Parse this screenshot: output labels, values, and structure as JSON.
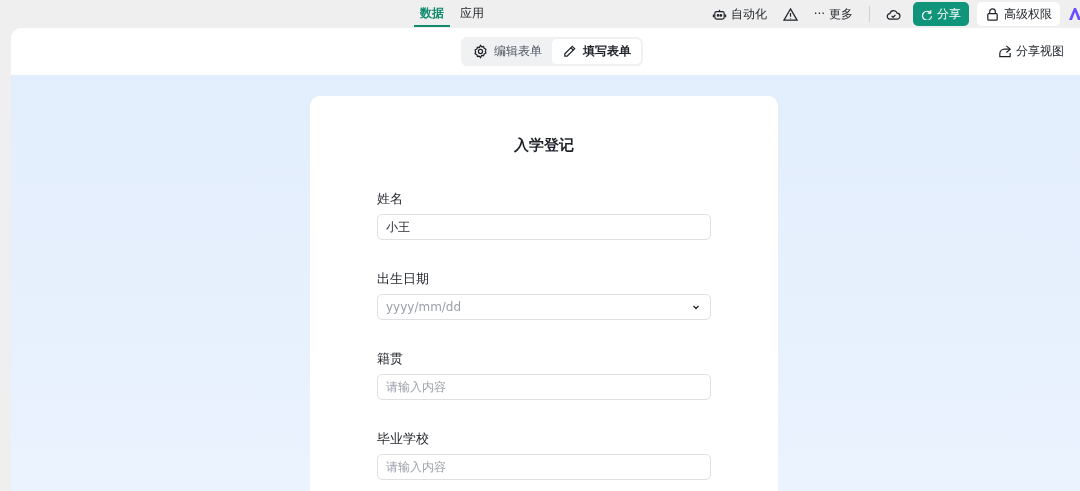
{
  "top_bar": {
    "tabs": [
      {
        "label": "数据",
        "selected": true
      },
      {
        "label": "应用",
        "selected": false
      }
    ],
    "actions": [
      {
        "kind": "automation",
        "label": "自动化"
      },
      {
        "kind": "warning"
      },
      {
        "kind": "more",
        "icon": "···",
        "label": "更多"
      },
      {
        "kind": "cloud"
      },
      {
        "kind": "share",
        "label": "分享"
      },
      {
        "kind": "permission",
        "label": "高级权限"
      },
      {
        "kind": "logo"
      }
    ]
  },
  "view_bar": {
    "modes": [
      {
        "label": "编辑表单",
        "kind": "edit",
        "selected": false
      },
      {
        "label": "填写表单",
        "kind": "fill",
        "selected": true
      }
    ],
    "share_view": "分享视图"
  },
  "form": {
    "title": "入学登记",
    "fields": [
      {
        "label": "姓名",
        "kind": "text",
        "value": "小王"
      },
      {
        "label": "出生日期",
        "kind": "date",
        "placeholder": "yyyy/mm/dd"
      },
      {
        "label": "籍贯",
        "kind": "text",
        "placeholder": "请输入内容"
      },
      {
        "label": "毕业学校",
        "kind": "text",
        "placeholder": "请输入内容"
      }
    ]
  }
}
